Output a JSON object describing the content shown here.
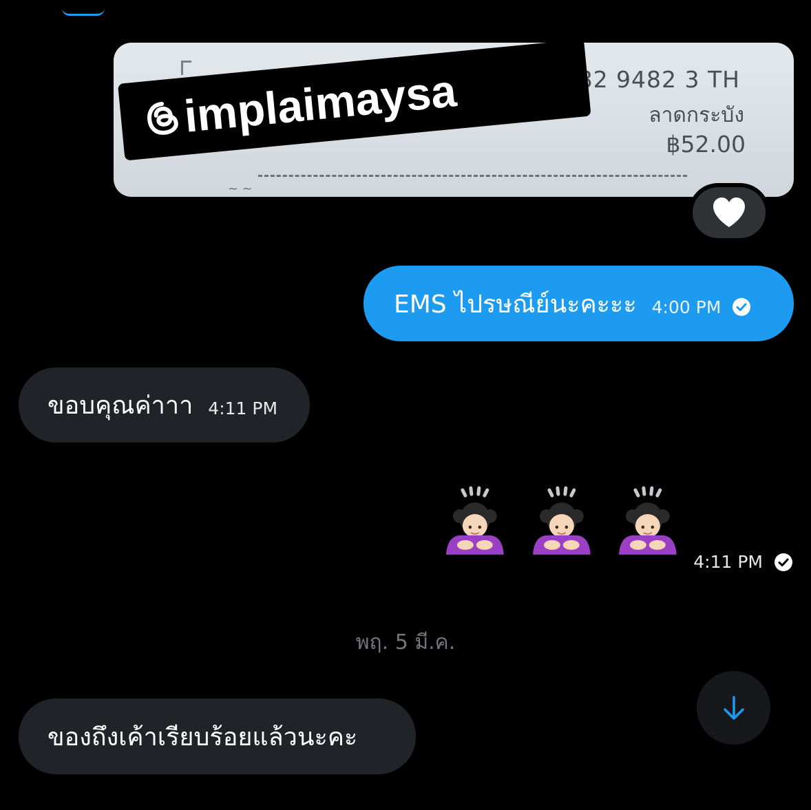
{
  "image_message": {
    "receipt_tracking": "82 9482 3 TH",
    "receipt_place": "ลาดกระบัง",
    "receipt_price": "฿52.00",
    "watermark_handle": "implaimaysa",
    "watermark_icon": "threads-icon"
  },
  "reaction": {
    "icon": "white-heart-icon"
  },
  "messages": [
    {
      "direction": "outgoing",
      "text": "EMS ไปรษณีย์นะคะะะ",
      "time": "4:00 PM",
      "status_icon": "check-circle-icon"
    },
    {
      "direction": "incoming",
      "text": "ขอบคุณค่าาา",
      "time": "4:11 PM"
    },
    {
      "direction": "outgoing",
      "emoji": [
        "woman-bowing-emoji",
        "woman-bowing-emoji",
        "woman-bowing-emoji"
      ],
      "time": "4:11 PM",
      "status_icon": "check-circle-icon"
    },
    {
      "direction": "incoming",
      "text": "ของถึงเค้าเรียบร้อยแล้วนะคะ"
    }
  ],
  "date_separator": "พฤ. 5 มี.ค.",
  "scroll_button": {
    "icon": "arrow-down-icon"
  },
  "colors": {
    "background": "#000000",
    "outgoing_bubble": "#1d9bf0",
    "incoming_bubble": "#202327",
    "muted_text": "#71767b",
    "accent": "#1d9bf0"
  }
}
